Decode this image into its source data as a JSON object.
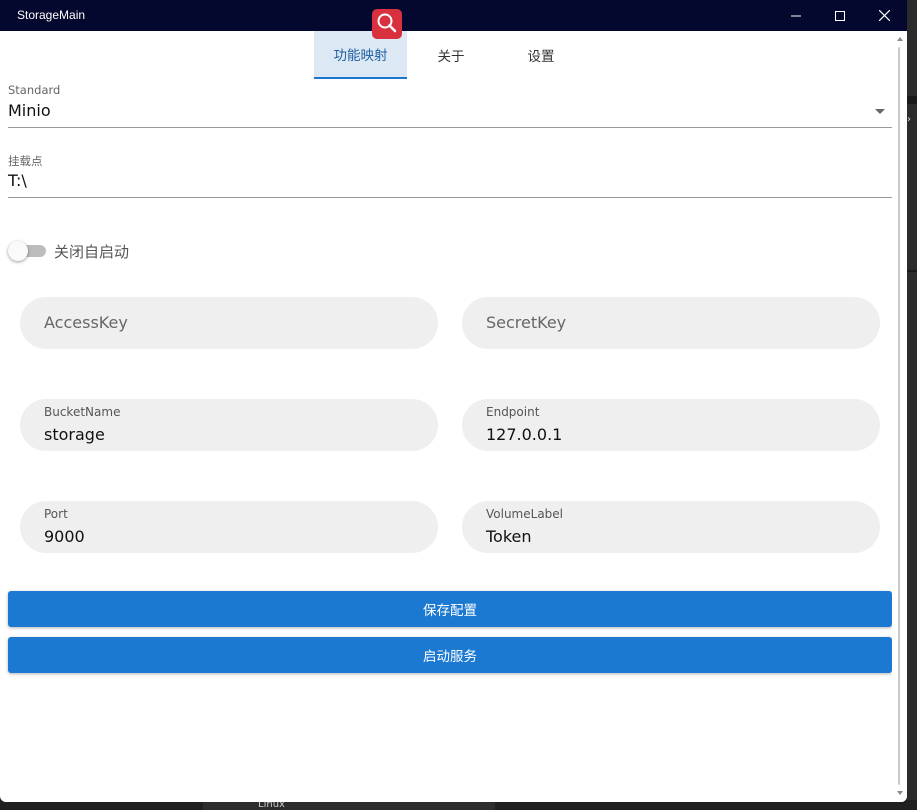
{
  "window": {
    "title": "StorageMain",
    "app_icon": "search-icon",
    "accent_color": "#d8303e",
    "titlebar_color": "#04072e"
  },
  "tabs": [
    {
      "label": "功能映射",
      "active": true
    },
    {
      "label": "关于",
      "active": false
    },
    {
      "label": "设置",
      "active": false
    }
  ],
  "standard_select": {
    "label": "Standard",
    "value": "Minio"
  },
  "mount_field": {
    "label": "挂载点",
    "value": "T:\\"
  },
  "autostart_toggle": {
    "label": "关闭自启动",
    "checked": false
  },
  "fields": {
    "access_key": {
      "placeholder": "AccessKey",
      "value": ""
    },
    "secret_key": {
      "placeholder": "SecretKey",
      "value": ""
    },
    "bucket_name": {
      "label": "BucketName",
      "value": "storage"
    },
    "endpoint": {
      "label": "Endpoint",
      "value": "127.0.0.1"
    },
    "port": {
      "label": "Port",
      "value": "9000"
    },
    "volume_label": {
      "label": "VolumeLabel",
      "value": "Token"
    }
  },
  "actions": {
    "save_label": "保存配置",
    "start_label": "启动服务",
    "button_color": "#1c79d2"
  },
  "background": {
    "taskbar_item": "Linux"
  }
}
